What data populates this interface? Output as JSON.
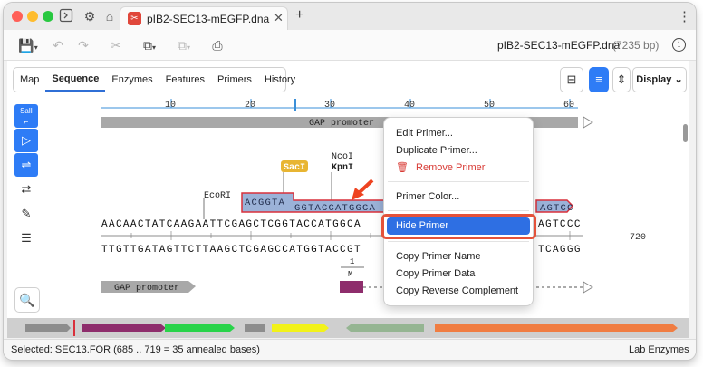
{
  "tab": {
    "title": "pIB2-SEC13-mEGFP.dna"
  },
  "toolbar": {
    "filename": "pIB2-SEC13-mEGFP.dna",
    "size": "(7235 bp)"
  },
  "view_tabs": [
    "Map",
    "Sequence",
    "Enzymes",
    "Features",
    "Primers",
    "History"
  ],
  "display_label": "Display",
  "sequence": {
    "ruler": [
      "10",
      "20",
      "30",
      "40",
      "50",
      "60"
    ],
    "position_right": "720",
    "top_strand": "AACAACTATCAAGAATTCGAGCTCGGTACCATGGCA",
    "top_strand_tail": "AGTCCC",
    "bottom_strand": "TTGTTGATAGTTCTTAAGCTCGAGCCATGGTACCGT",
    "bottom_strand_tail": "TCAGGG",
    "primer_overhang": "ACGGTA",
    "primer_annealed": "GGTACCATGGCA",
    "primer_tail": "AGTCC",
    "enzymes": {
      "ecori": "EcoRI",
      "saci": "SacI",
      "ncoi": "NcoI",
      "kpni": "KpnI"
    },
    "features": {
      "gap_promoter_top": "GAP promoter",
      "gap_promoter_bottom": "GAP promoter",
      "marker_num": "1",
      "marker_letter": "M"
    }
  },
  "context_menu": {
    "items": [
      "Edit Primer...",
      "Duplicate Primer...",
      "Remove Primer",
      "Primer Color...",
      "Hide Primer",
      "Copy Primer Name",
      "Copy Primer Data",
      "Copy Reverse Complement"
    ],
    "highlighted": "Hide Primer"
  },
  "status": {
    "selected": "Selected:  SEC13.FOR  (685 .. 719  =  35 annealed bases)",
    "enzymes": "Lab Enzymes"
  },
  "colors": {
    "accent": "#2e7cf6",
    "primer": "#9bb2d8",
    "primer_border": "#d9303b",
    "saci": "#e8b532",
    "highlight_ring": "#e4523a"
  }
}
